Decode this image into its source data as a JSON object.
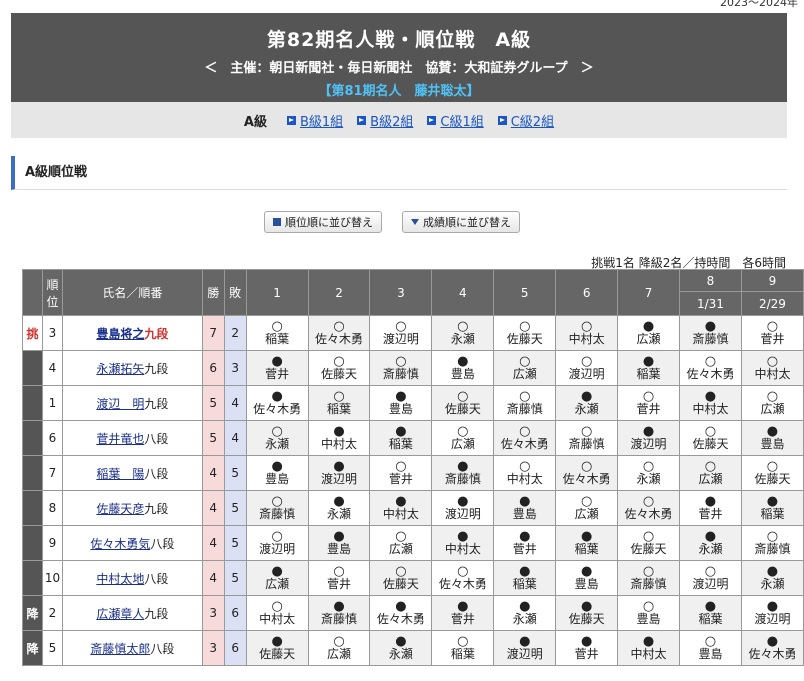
{
  "corner_note": "2023〜2024年",
  "banner": {
    "title": "第82期名人戦・順位戦　A級",
    "sponsors": "＜　主催：朝日新聞社・毎日新聞社　協賛：大和証券グループ　＞",
    "champion": "【第81期名人　藤井聡太】"
  },
  "subnav": {
    "current": "A級",
    "links": [
      "B級1組",
      "B級2組",
      "C級1組",
      "C級2組"
    ]
  },
  "section_title": "A級順位戦",
  "sort_buttons": [
    "順位順に並び替え",
    "成績順に並び替え"
  ],
  "table_note": "挑戦1名 降級2名／持時間　各6時間",
  "headers": {
    "seq": "順位",
    "name": "氏名／順番",
    "win": "勝",
    "loss": "敗",
    "rounds": [
      "1",
      "2",
      "3",
      "4",
      "5",
      "6",
      "7",
      "8",
      "9"
    ],
    "dates": [
      "",
      "",
      "",
      "",
      "",
      "",
      "",
      "1/31",
      "2/29"
    ]
  },
  "players": [
    {
      "status": "挑",
      "seq": "3",
      "name": "豊島将之",
      "rank": "九段",
      "w": "7",
      "l": "2",
      "games": [
        [
          "○",
          "稲葉"
        ],
        [
          "○",
          "佐々木勇"
        ],
        [
          "○",
          "渡辺明"
        ],
        [
          "○",
          "永瀬"
        ],
        [
          "○",
          "佐藤天"
        ],
        [
          "○",
          "中村太"
        ],
        [
          "●",
          "広瀬"
        ],
        [
          "●",
          "斎藤慎"
        ],
        [
          "○",
          "菅井"
        ]
      ]
    },
    {
      "status": "",
      "seq": "4",
      "name": "永瀬拓矢",
      "rank": "九段",
      "w": "6",
      "l": "3",
      "games": [
        [
          "●",
          "菅井"
        ],
        [
          "○",
          "佐藤天"
        ],
        [
          "○",
          "斎藤慎"
        ],
        [
          "●",
          "豊島"
        ],
        [
          "○",
          "広瀬"
        ],
        [
          "○",
          "渡辺明"
        ],
        [
          "●",
          "稲葉"
        ],
        [
          "○",
          "佐々木勇"
        ],
        [
          "○",
          "中村太"
        ]
      ]
    },
    {
      "status": "",
      "seq": "1",
      "name": "渡辺　明",
      "rank": "九段",
      "w": "5",
      "l": "4",
      "games": [
        [
          "●",
          "佐々木勇"
        ],
        [
          "○",
          "稲葉"
        ],
        [
          "●",
          "豊島"
        ],
        [
          "○",
          "佐藤天"
        ],
        [
          "○",
          "斎藤慎"
        ],
        [
          "●",
          "永瀬"
        ],
        [
          "○",
          "菅井"
        ],
        [
          "●",
          "中村太"
        ],
        [
          "○",
          "広瀬"
        ]
      ]
    },
    {
      "status": "",
      "seq": "6",
      "name": "菅井竜也",
      "rank": "八段",
      "w": "5",
      "l": "4",
      "games": [
        [
          "○",
          "永瀬"
        ],
        [
          "●",
          "中村太"
        ],
        [
          "●",
          "稲葉"
        ],
        [
          "○",
          "広瀬"
        ],
        [
          "○",
          "佐々木勇"
        ],
        [
          "○",
          "斎藤慎"
        ],
        [
          "●",
          "渡辺明"
        ],
        [
          "○",
          "佐藤天"
        ],
        [
          "●",
          "豊島"
        ]
      ]
    },
    {
      "status": "",
      "seq": "7",
      "name": "稲葉　陽",
      "rank": "八段",
      "w": "4",
      "l": "5",
      "games": [
        [
          "●",
          "豊島"
        ],
        [
          "●",
          "渡辺明"
        ],
        [
          "○",
          "菅井"
        ],
        [
          "●",
          "斎藤慎"
        ],
        [
          "○",
          "中村太"
        ],
        [
          "○",
          "佐々木勇"
        ],
        [
          "○",
          "永瀬"
        ],
        [
          "○",
          "広瀬"
        ],
        [
          "○",
          "佐藤天"
        ]
      ]
    },
    {
      "status": "",
      "seq": "8",
      "name": "佐藤天彦",
      "rank": "九段",
      "w": "4",
      "l": "5",
      "games": [
        [
          "○",
          "斎藤慎"
        ],
        [
          "●",
          "永瀬"
        ],
        [
          "●",
          "中村太"
        ],
        [
          "●",
          "渡辺明"
        ],
        [
          "●",
          "豊島"
        ],
        [
          "○",
          "広瀬"
        ],
        [
          "○",
          "佐々木勇"
        ],
        [
          "●",
          "菅井"
        ],
        [
          "●",
          "稲葉"
        ]
      ]
    },
    {
      "status": "",
      "seq": "9",
      "name": "佐々木勇気",
      "rank": "八段",
      "w": "4",
      "l": "5",
      "games": [
        [
          "○",
          "渡辺明"
        ],
        [
          "●",
          "豊島"
        ],
        [
          "○",
          "広瀬"
        ],
        [
          "●",
          "中村太"
        ],
        [
          "●",
          "菅井"
        ],
        [
          "●",
          "稲葉"
        ],
        [
          "○",
          "佐藤天"
        ],
        [
          "●",
          "永瀬"
        ],
        [
          "○",
          "斎藤慎"
        ]
      ]
    },
    {
      "status": "",
      "seq": "10",
      "name": "中村太地",
      "rank": "八段",
      "w": "4",
      "l": "5",
      "games": [
        [
          "●",
          "広瀬"
        ],
        [
          "○",
          "菅井"
        ],
        [
          "○",
          "佐藤天"
        ],
        [
          "○",
          "佐々木勇"
        ],
        [
          "●",
          "稲葉"
        ],
        [
          "●",
          "豊島"
        ],
        [
          "○",
          "斎藤慎"
        ],
        [
          "○",
          "渡辺明"
        ],
        [
          "●",
          "永瀬"
        ]
      ]
    },
    {
      "status": "降",
      "seq": "2",
      "name": "広瀬章人",
      "rank": "九段",
      "w": "3",
      "l": "6",
      "games": [
        [
          "○",
          "中村太"
        ],
        [
          "●",
          "斎藤慎"
        ],
        [
          "●",
          "佐々木勇"
        ],
        [
          "●",
          "菅井"
        ],
        [
          "●",
          "永瀬"
        ],
        [
          "●",
          "佐藤天"
        ],
        [
          "○",
          "豊島"
        ],
        [
          "●",
          "稲葉"
        ],
        [
          "●",
          "渡辺明"
        ]
      ]
    },
    {
      "status": "降",
      "seq": "5",
      "name": "斎藤慎太郎",
      "rank": "八段",
      "w": "3",
      "l": "6",
      "games": [
        [
          "●",
          "佐藤天"
        ],
        [
          "○",
          "広瀬"
        ],
        [
          "●",
          "永瀬"
        ],
        [
          "○",
          "稲葉"
        ],
        [
          "●",
          "渡辺明"
        ],
        [
          "●",
          "菅井"
        ],
        [
          "●",
          "中村太"
        ],
        [
          "○",
          "豊島"
        ],
        [
          "●",
          "佐々木勇"
        ]
      ]
    }
  ]
}
